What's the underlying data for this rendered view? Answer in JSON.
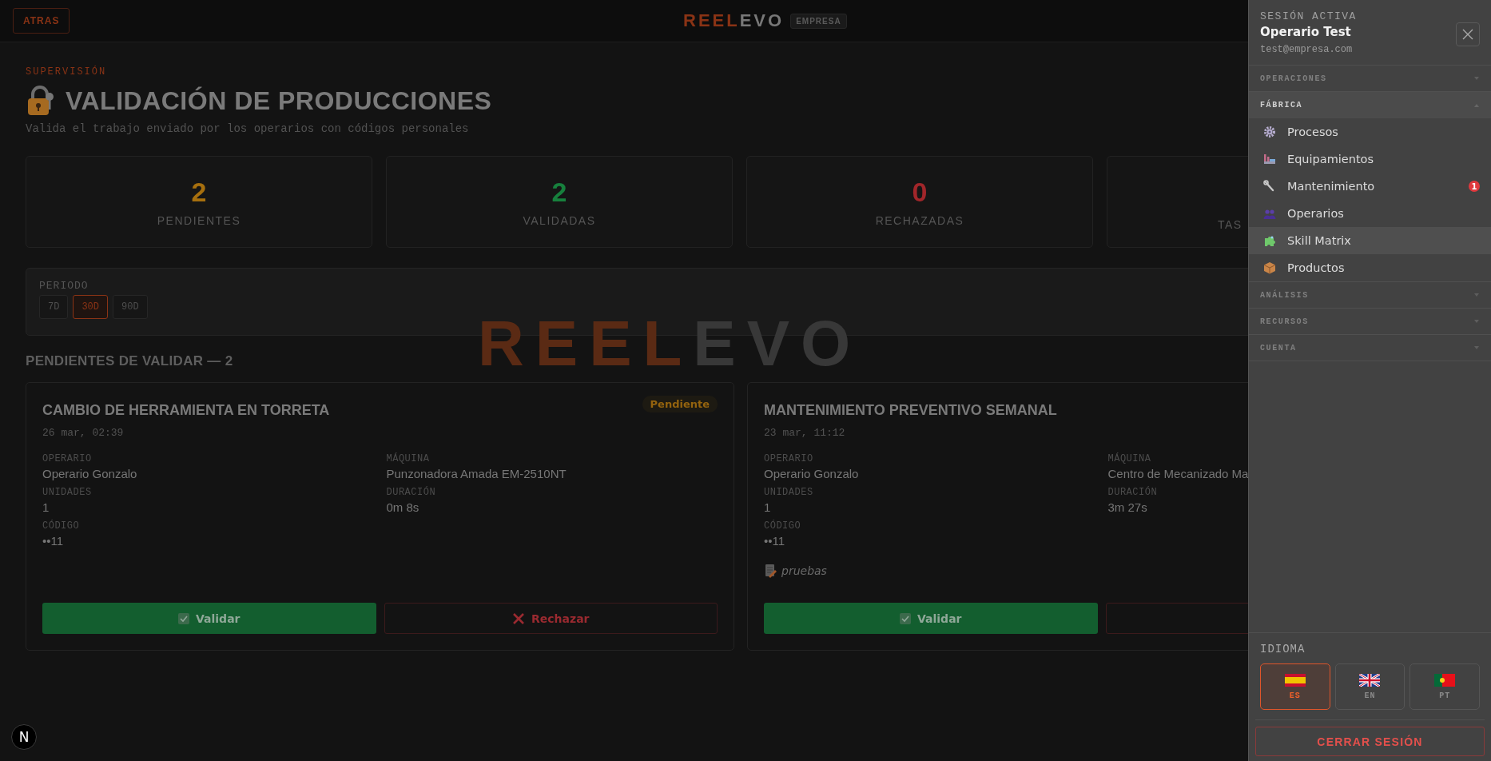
{
  "header": {
    "back_button": "ATRAS",
    "logo": {
      "part_1": "REEL",
      "part_2": "EVO"
    },
    "logo_badge": "EMPRESA"
  },
  "page": {
    "eyebrow": "SUPERVISIÓN",
    "title": "VALIDACIÓN DE PRODUCCIONES",
    "subtitle": "Valida el trabajo enviado por los operarios con códigos personales"
  },
  "stats": [
    {
      "value": "2",
      "label": "PENDIENTES",
      "color": "#a66f0e"
    },
    {
      "value": "2",
      "label": "VALIDADAS",
      "color": "#17803d"
    },
    {
      "value": "0",
      "label": "RECHAZADAS",
      "color": "#a1262a"
    },
    {
      "label": "TAS"
    }
  ],
  "period": {
    "label": "PERIODO",
    "options": [
      {
        "label": "7D",
        "selected": false
      },
      {
        "label": "30D",
        "selected": true
      },
      {
        "label": "90D",
        "selected": false
      }
    ]
  },
  "background_logo": {
    "part_1": "REEL",
    "part_2": "EVO"
  },
  "pending": {
    "title": "PENDIENTES DE VALIDAR — 2",
    "cards": [
      {
        "title": "CAMBIO DE HERRAMIENTA EN TORRETA",
        "date": "26 mar, 02:39",
        "status": "Pendiente",
        "fields": [
          {
            "label": "OPERARIO",
            "value": "Operario Gonzalo"
          },
          {
            "label": "MÁQUINA",
            "value": "Punzonadora Amada EM-2510NT"
          },
          {
            "label": "UNIDADES",
            "value": "1"
          },
          {
            "label": "DURACIÓN",
            "value": "0m 8s"
          },
          {
            "label": "CÓDIGO",
            "value": "••11"
          }
        ],
        "validate_label": "Validar",
        "reject_label": "Rechazar"
      },
      {
        "title": "MANTENIMIENTO PREVENTIVO SEMANAL",
        "date": "23 mar, 11:12",
        "fields": [
          {
            "label": "OPERARIO",
            "value": "Operario Gonzalo"
          },
          {
            "label": "MÁQUINA",
            "value": "Centro de Mecanizado Ma"
          },
          {
            "label": "UNIDADES",
            "value": "1"
          },
          {
            "label": "DURACIÓN",
            "value": "3m 27s"
          },
          {
            "label": "CÓDIGO",
            "value": "••11"
          }
        ],
        "note": "pruebas",
        "validate_label": "Validar"
      }
    ]
  },
  "dev_badge": "N",
  "drawer": {
    "session_label": "SESIÓN ACTIVA",
    "user_name": "Operario Test",
    "user_email": "test@empresa.com",
    "sections": [
      {
        "title": "OPERACIONES",
        "expanded": false
      },
      {
        "title": "FÁBRICA",
        "expanded": true,
        "items": [
          {
            "label": "Procesos",
            "selected": false
          },
          {
            "label": "Equipamientos",
            "selected": false
          },
          {
            "label": "Mantenimiento",
            "selected": false,
            "badge": "1"
          },
          {
            "label": "Operarios",
            "selected": false
          },
          {
            "label": "Skill Matrix",
            "selected": true
          },
          {
            "label": "Productos",
            "selected": false
          }
        ]
      },
      {
        "title": "ANÁLISIS",
        "expanded": false
      },
      {
        "title": "RECURSOS",
        "expanded": false
      },
      {
        "title": "CUENTA",
        "expanded": false
      }
    ],
    "language_label": "IDIOMA",
    "languages": [
      {
        "code": "ES",
        "selected": true
      },
      {
        "code": "EN",
        "selected": false
      },
      {
        "code": "PT",
        "selected": false
      }
    ],
    "logout_button": "CERRAR SESIÓN"
  }
}
